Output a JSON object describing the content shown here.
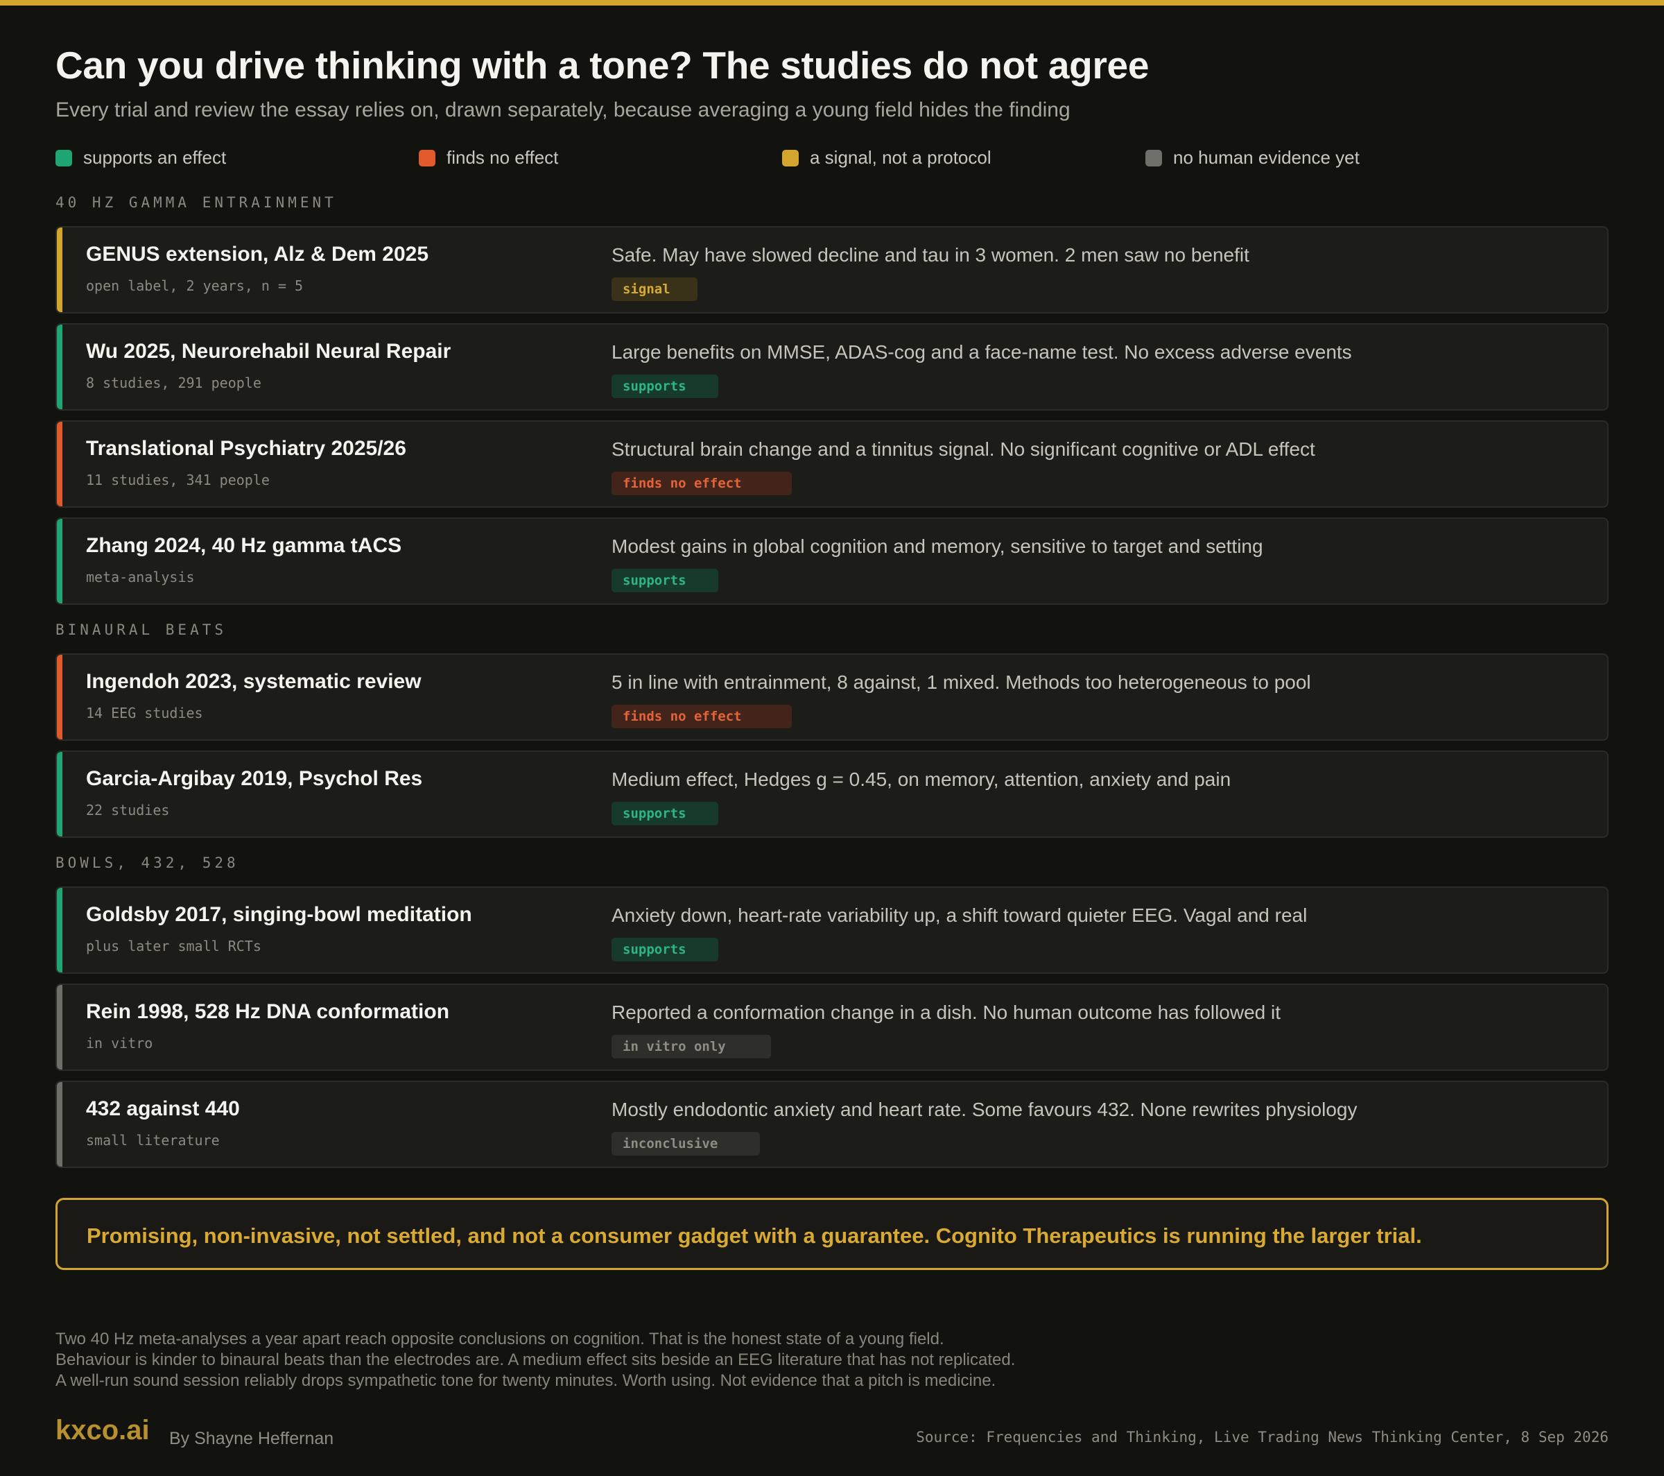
{
  "title": "Can you drive thinking with a tone? The studies do not agree",
  "subtitle": "Every trial and review the essay relies on, drawn separately, because averaging a young field hides the finding",
  "colors": {
    "accent": "#d4a52c",
    "supports": "#1fa574",
    "no_effect": "#e05a2c",
    "signal": "#d4a52c",
    "no_human": "#6f6f69"
  },
  "legend": [
    {
      "label": "supports an effect",
      "color": "#1fa574"
    },
    {
      "label": "finds no effect",
      "color": "#e05a2c"
    },
    {
      "label": "a signal, not a protocol",
      "color": "#d4a52c"
    },
    {
      "label": "no human evidence yet",
      "color": "#6f6f69"
    }
  ],
  "sections": [
    {
      "heading": "40 HZ GAMMA ENTRAINMENT",
      "rows": [
        {
          "title": "GENUS extension, Alz & Dem 2025",
          "meta": "open label, 2 years, n = 5",
          "finding": "Safe. May have slowed decline and tau in 3 women. 2 men saw no benefit",
          "badge": "signal",
          "status": "signal"
        },
        {
          "title": "Wu 2025, Neurorehabil Neural Repair",
          "meta": "8 studies, 291 people",
          "finding": "Large benefits on MMSE, ADAS-cog and a face-name test. No excess adverse events",
          "badge": "supports",
          "status": "supports"
        },
        {
          "title": "Translational Psychiatry 2025/26",
          "meta": "11 studies, 341 people",
          "finding": "Structural brain change and a tinnitus signal. No significant cognitive or ADL effect",
          "badge": "finds no effect",
          "status": "no_effect"
        },
        {
          "title": "Zhang 2024, 40 Hz gamma tACS",
          "meta": "meta-analysis",
          "finding": "Modest gains in global cognition and memory, sensitive to target and setting",
          "badge": "supports",
          "status": "supports"
        }
      ]
    },
    {
      "heading": "BINAURAL BEATS",
      "rows": [
        {
          "title": "Ingendoh 2023, systematic review",
          "meta": "14 EEG studies",
          "finding": "5 in line with entrainment, 8 against, 1 mixed. Methods too heterogeneous to pool",
          "badge": "finds no effect",
          "status": "no_effect"
        },
        {
          "title": "Garcia-Argibay 2019, Psychol Res",
          "meta": "22 studies",
          "finding": "Medium effect, Hedges g = 0.45, on memory, attention, anxiety and pain",
          "badge": "supports",
          "status": "supports"
        }
      ]
    },
    {
      "heading": "BOWLS, 432, 528",
      "rows": [
        {
          "title": "Goldsby 2017, singing-bowl meditation",
          "meta": "plus later small RCTs",
          "finding": "Anxiety down, heart-rate variability up, a shift toward quieter EEG. Vagal and real",
          "badge": "supports",
          "status": "supports"
        },
        {
          "title": "Rein 1998, 528 Hz DNA conformation",
          "meta": "in vitro",
          "finding": "Reported a conformation change in a dish. No human outcome has followed it",
          "badge": "in vitro only",
          "status": "no_human"
        },
        {
          "title": "432 against 440",
          "meta": "small literature",
          "finding": "Mostly endodontic anxiety and heart rate. Some favours 432. None rewrites physiology",
          "badge": "inconclusive",
          "status": "no_human"
        }
      ]
    }
  ],
  "callout": "Promising, non-invasive, not settled, and not a consumer gadget with a guarantee. Cognito Therapeutics is running the larger trial.",
  "notes": [
    "Two 40 Hz meta-analyses a year apart reach opposite conclusions on cognition. That is the honest state of a young field.",
    "Behaviour is kinder to binaural beats than the electrodes are. A medium effect sits beside an EEG literature that has not replicated.",
    "A well-run sound session reliably drops sympathetic tone for twenty minutes. Worth using. Not evidence that a pitch is medicine."
  ],
  "footer": {
    "brand": "kxco.ai",
    "byline": "By Shayne Heffernan",
    "source": "Source: Frequencies and Thinking, Live Trading News Thinking Center, 8 Sep 2026"
  }
}
